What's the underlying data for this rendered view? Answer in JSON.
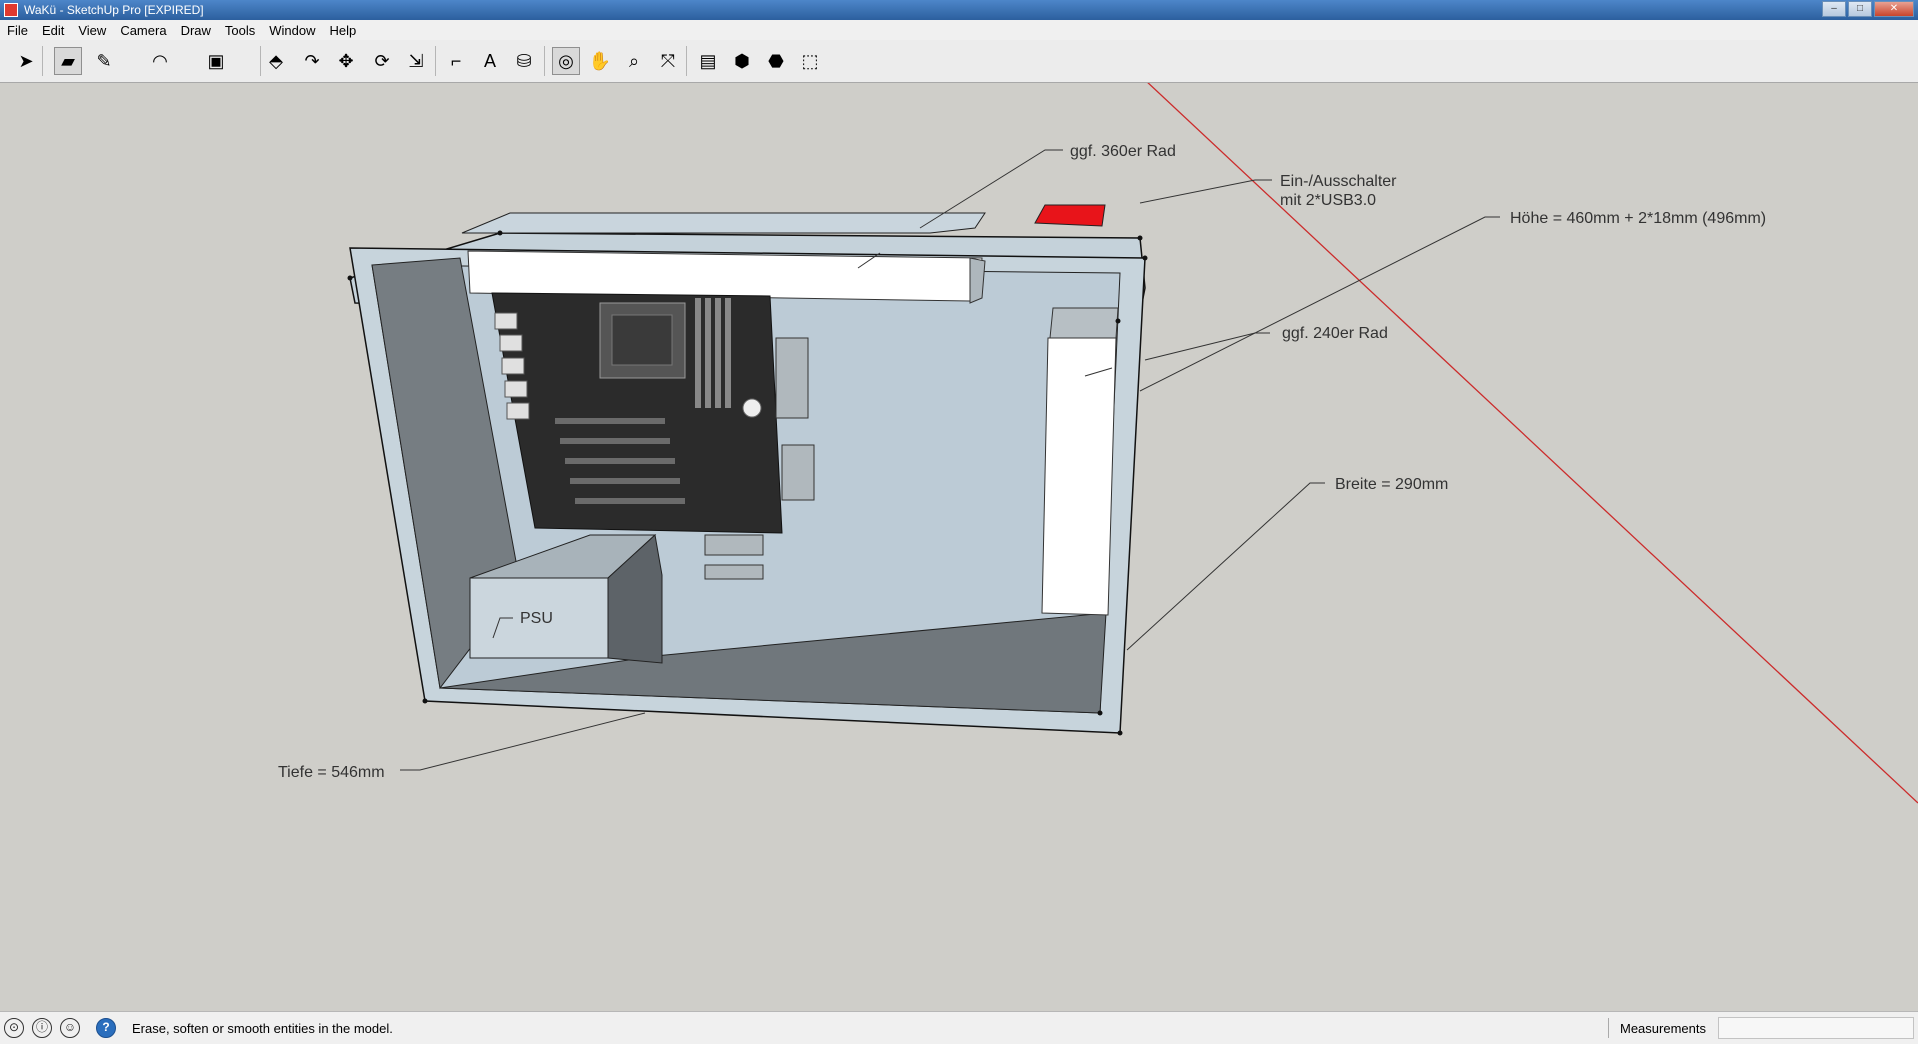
{
  "window": {
    "title": "WaKü - SketchUp Pro [EXPIRED]"
  },
  "menu": [
    "File",
    "Edit",
    "View",
    "Camera",
    "Draw",
    "Tools",
    "Window",
    "Help"
  ],
  "toolbar": {
    "tools": [
      {
        "name": "select-tool",
        "icon": "arrow-icon",
        "glyph": "➤"
      },
      {
        "name": "eraser-tool",
        "icon": "eraser-icon",
        "glyph": "▰",
        "active": true
      },
      {
        "name": "line-tool",
        "icon": "pencil-icon",
        "glyph": "✎"
      },
      {
        "name": "arc-tool",
        "icon": "arc-icon",
        "glyph": "◠"
      },
      {
        "name": "shape-tool",
        "icon": "rectangle-icon",
        "glyph": "▣"
      },
      {
        "name": "push-pull-tool",
        "icon": "push-pull-icon",
        "glyph": "⬘"
      },
      {
        "name": "offset-tool",
        "icon": "offset-icon",
        "glyph": "↷"
      },
      {
        "name": "move-tool",
        "icon": "move-icon",
        "glyph": "✥"
      },
      {
        "name": "rotate-tool",
        "icon": "rotate-icon",
        "glyph": "⟳"
      },
      {
        "name": "scale-tool",
        "icon": "scale-icon",
        "glyph": "⇲"
      },
      {
        "name": "tape-measure-tool",
        "icon": "tape-measure-icon",
        "glyph": "⌐"
      },
      {
        "name": "text-tool",
        "icon": "text-icon",
        "glyph": "A"
      },
      {
        "name": "paint-bucket-tool",
        "icon": "paint-bucket-icon",
        "glyph": "⛁"
      },
      {
        "name": "orbit-tool",
        "icon": "orbit-icon",
        "glyph": "◎",
        "active": true
      },
      {
        "name": "pan-tool",
        "icon": "hand-icon",
        "glyph": "✋"
      },
      {
        "name": "zoom-tool",
        "icon": "magnifier-icon",
        "glyph": "⌕"
      },
      {
        "name": "zoom-extents-tool",
        "icon": "zoom-extents-icon",
        "glyph": "⤧"
      },
      {
        "name": "warehouse-tool",
        "icon": "warehouse-icon",
        "glyph": "▤"
      },
      {
        "name": "share-model-tool",
        "icon": "share-model-icon",
        "glyph": "⬢"
      },
      {
        "name": "components-tool",
        "icon": "components-icon",
        "glyph": "⬣"
      },
      {
        "name": "extensions-tool",
        "icon": "extension-icon",
        "glyph": "⬚"
      }
    ]
  },
  "model": {
    "annotations": {
      "top_radiator": "ggf. 360er Rad",
      "switch_line1": "Ein-/Ausschalter",
      "switch_line2": "mit 2*USB3.0",
      "height": "Höhe = 460mm + 2*18mm (496mm)",
      "side_radiator": "ggf. 240er Rad",
      "width": "Breite = 290mm",
      "psu": "PSU",
      "depth": "Tiefe = 546mm"
    },
    "colors": {
      "case_face": "#c7d4dc",
      "case_inner": "#6f767c",
      "power_switch": "#e8141a",
      "axis_red": "#cc2b2b"
    }
  },
  "status": {
    "text": "Erase, soften or smooth entities in the model.",
    "measurements_label": "Measurements",
    "measurements_value": ""
  }
}
